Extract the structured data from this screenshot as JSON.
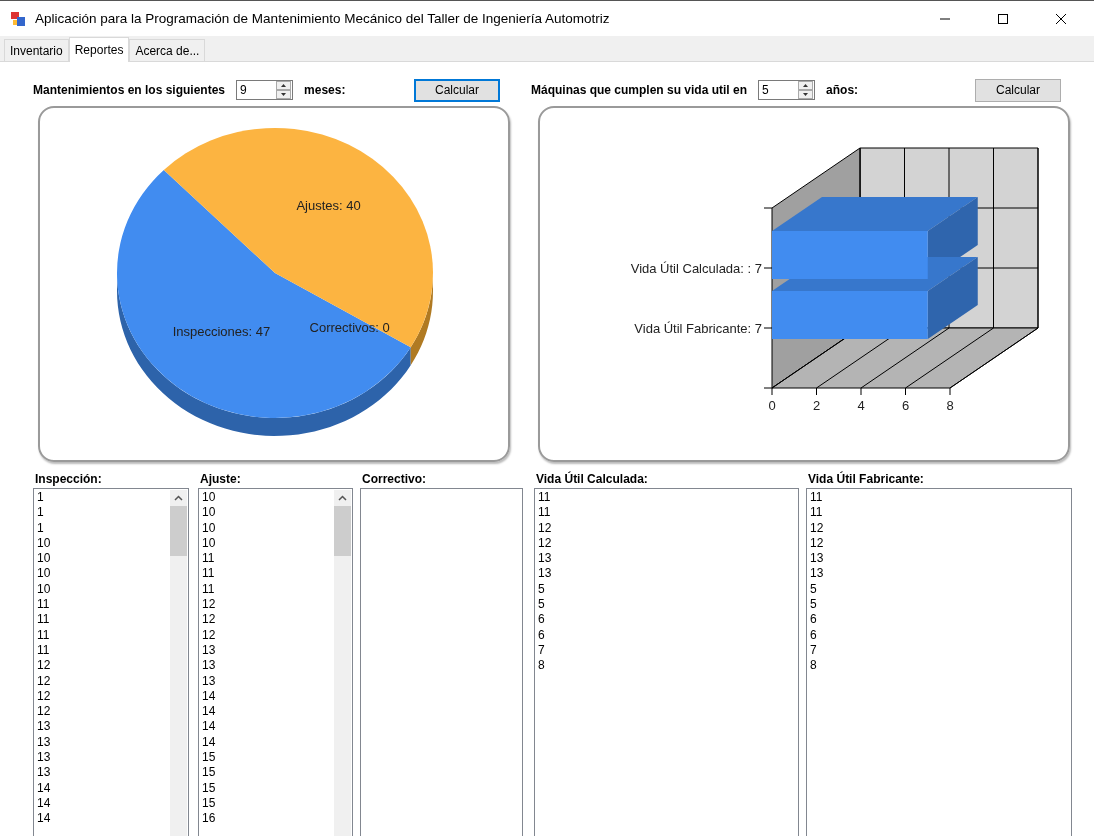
{
  "window": {
    "title": "Aplicación para la Programación de Mantenimiento Mecánico del Taller de Ingeniería Automotriz"
  },
  "tabs": [
    {
      "label": "Inventario",
      "selected": false
    },
    {
      "label": "Reportes",
      "selected": true
    },
    {
      "label": "Acerca de...",
      "selected": false
    }
  ],
  "maintenance": {
    "label": "Mantenimientos en los siguientes",
    "value": "9",
    "unit_label": "meses:",
    "button": {
      "label": "Calcular",
      "focused": true
    },
    "chart_data": {
      "type": "pie",
      "categories": [
        "Inspecciones: 47",
        "Ajustes: 40",
        "Correctivos: 0"
      ],
      "values": [
        47,
        40,
        0
      ]
    }
  },
  "lifespan": {
    "label": "Máquinas que cumplen su vida util en",
    "value": "5",
    "unit_label": "años:",
    "button": {
      "label": "Calcular",
      "focused": false
    },
    "chart_data": {
      "type": "bar",
      "orientation": "horizontal",
      "grid": true,
      "categories": [
        "Vida Útil Calculada: : 7",
        "Vida Útil Fabricante: 7"
      ],
      "series": [
        {
          "color": "#418cf0",
          "values": [
            7,
            7
          ]
        }
      ],
      "xlim": [
        0,
        8
      ],
      "xticks": [
        0,
        2,
        4,
        6,
        8
      ]
    }
  },
  "lists": [
    {
      "label": "Inspección:",
      "scrollable": true,
      "items": [
        "1",
        "1",
        "1",
        "10",
        "10",
        "10",
        "10",
        "11",
        "11",
        "11",
        "11",
        "12",
        "12",
        "12",
        "12",
        "13",
        "13",
        "13",
        "13",
        "14",
        "14",
        "14"
      ]
    },
    {
      "label": "Ajuste:",
      "scrollable": true,
      "items": [
        "10",
        "10",
        "10",
        "10",
        "11",
        "11",
        "11",
        "12",
        "12",
        "12",
        "13",
        "13",
        "13",
        "14",
        "14",
        "14",
        "14",
        "15",
        "15",
        "15",
        "15",
        "16"
      ]
    },
    {
      "label": "Correctivo:",
      "scrollable": false
    },
    {
      "label": "Vida Útil Calculada:",
      "scrollable": false,
      "items": [
        "11",
        "11",
        "12",
        "12",
        "13",
        "13",
        "5",
        "5",
        "6",
        "6",
        "7",
        "8"
      ]
    },
    {
      "label": "Vida Útil Fabricante:",
      "scrollable": false,
      "items": [
        "11",
        "11",
        "12",
        "12",
        "13",
        "13",
        "5",
        "5",
        "6",
        "6",
        "7",
        "8"
      ]
    }
  ]
}
